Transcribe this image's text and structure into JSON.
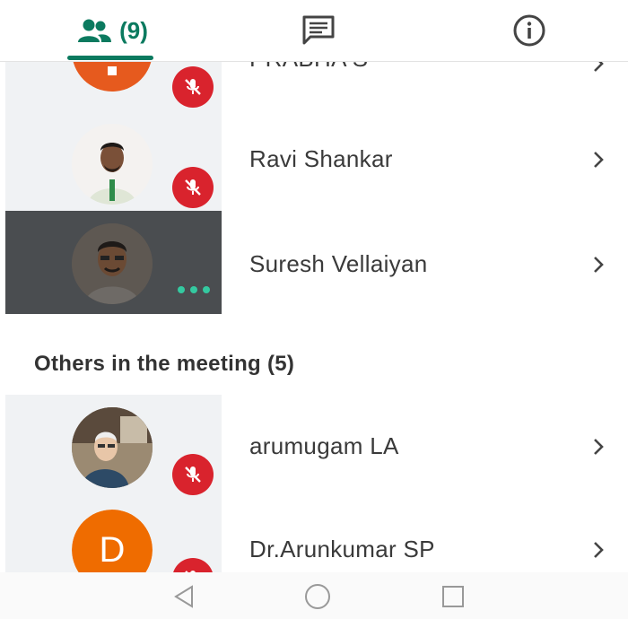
{
  "tabs": {
    "people_count": "(9)"
  },
  "participants": [
    {
      "name": "PRABHA S",
      "muted": true
    },
    {
      "name": "Ravi Shankar",
      "muted": true
    },
    {
      "name": "Suresh Vellaiyan",
      "speaking": true
    }
  ],
  "others": {
    "title": "Others in the meeting (5)",
    "items": [
      {
        "name": "arumugam LA",
        "muted": true
      },
      {
        "name": "Dr.Arunkumar SP",
        "initial": "D",
        "muted": true
      }
    ]
  },
  "colors": {
    "accent": "#0b7a5f",
    "mute_red": "#d9232d",
    "avatar_orange": "#ef6c00",
    "speaking_dots": "#34c9a0"
  }
}
